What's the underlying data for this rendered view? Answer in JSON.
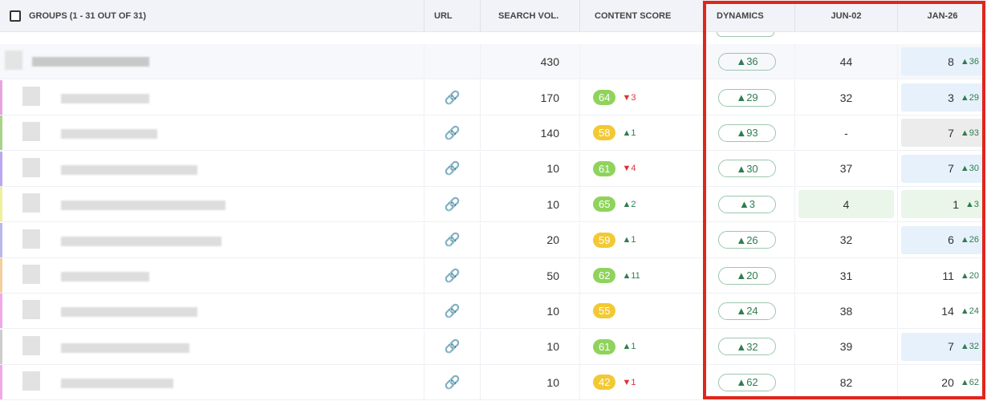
{
  "header": {
    "groups": "GROUPS (1 - 31 OUT OF 31)",
    "url": "URL",
    "search_vol": "SEARCH VOL.",
    "content_score": "CONTENT SCORE",
    "dynamics": "DYNAMICS",
    "jun": "JUN-02",
    "jan": "JAN-26"
  },
  "colors": {
    "score_green": "#8fd35c",
    "score_yellow": "#f2c935",
    "jan_blue": "#e6f1fb",
    "jan_grey": "#ececec",
    "jan_green": "#e9f6e9",
    "frame": "#e0261c"
  },
  "group_row": {
    "search_vol": "430",
    "dynamics": "▲36",
    "jun": "44",
    "jan": "8",
    "jan_delta": "▲36"
  },
  "rows": [
    {
      "search_vol": "170",
      "score": "64",
      "score_delta": "▼3",
      "dynamics": "▲29",
      "jun": "32",
      "jan": "3",
      "jan_delta": "▲29"
    },
    {
      "search_vol": "140",
      "score": "58",
      "score_delta": "▲1",
      "dynamics": "▲93",
      "jun": "-",
      "jan": "7",
      "jan_delta": "▲93"
    },
    {
      "search_vol": "10",
      "score": "61",
      "score_delta": "▼4",
      "dynamics": "▲30",
      "jun": "37",
      "jan": "7",
      "jan_delta": "▲30"
    },
    {
      "search_vol": "10",
      "score": "65",
      "score_delta": "▲2",
      "dynamics": "▲3",
      "jun": "4",
      "jan": "1",
      "jan_delta": "▲3"
    },
    {
      "search_vol": "20",
      "score": "59",
      "score_delta": "▲1",
      "dynamics": "▲26",
      "jun": "32",
      "jan": "6",
      "jan_delta": "▲26"
    },
    {
      "search_vol": "50",
      "score": "62",
      "score_delta": "▲11",
      "dynamics": "▲20",
      "jun": "31",
      "jan": "11",
      "jan_delta": "▲20"
    },
    {
      "search_vol": "10",
      "score": "55",
      "score_delta": "",
      "dynamics": "▲24",
      "jun": "38",
      "jan": "14",
      "jan_delta": "▲24"
    },
    {
      "search_vol": "10",
      "score": "61",
      "score_delta": "▲1",
      "dynamics": "▲32",
      "jun": "39",
      "jan": "7",
      "jan_delta": "▲32"
    },
    {
      "search_vol": "10",
      "score": "42",
      "score_delta": "▼1",
      "dynamics": "▲62",
      "jun": "82",
      "jan": "20",
      "jan_delta": "▲62"
    }
  ]
}
